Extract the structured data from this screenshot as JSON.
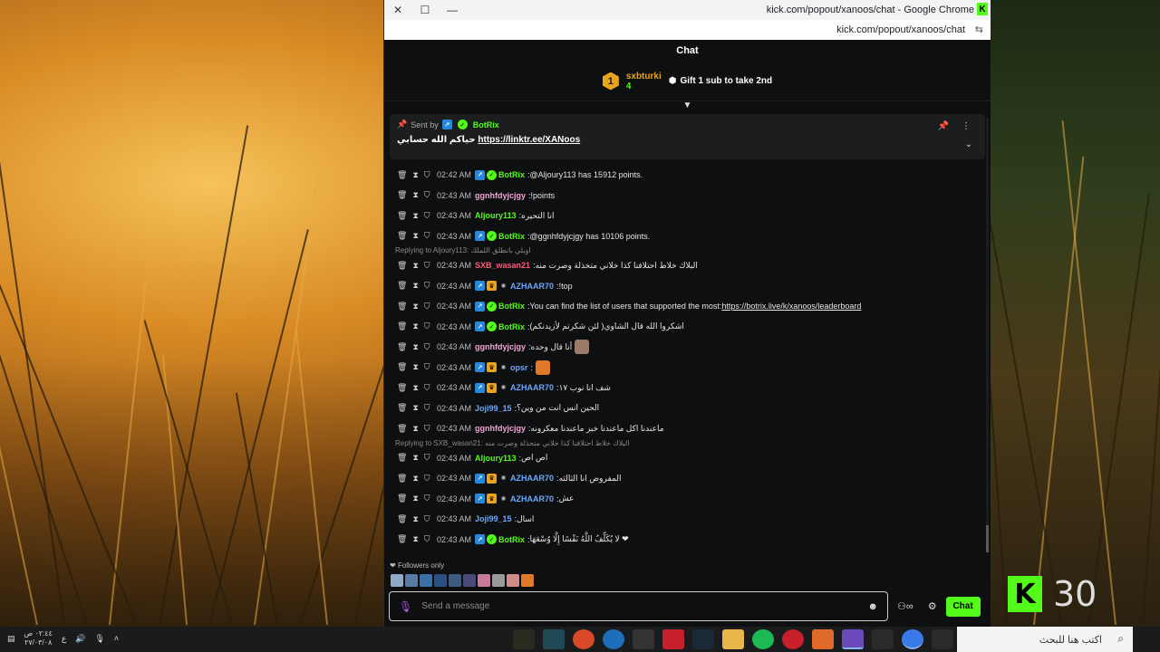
{
  "window": {
    "title": "kick.com/popout/xanoos/chat - Google Chrome",
    "url": "kick.com/popout/xanoos/chat"
  },
  "chat": {
    "header": "Chat",
    "leaderboard": {
      "rank": "1",
      "user": "sxbturki",
      "count": "4",
      "gift_text": "Gift 1 sub to take 2nd"
    },
    "pinned": {
      "sent_by_label": "Sent by",
      "sender": "BotRix",
      "message_prefix": "حياكم الله حسابي",
      "link": "https://linktr.ee/XANoos"
    },
    "messages": [
      {
        "time": "02:42 AM",
        "user": "BotRix",
        "color": "#53fc18",
        "badges": [
          "blue",
          "green"
        ],
        "text": "@Aljoury113 has 15912 points."
      },
      {
        "time": "02:43 AM",
        "user": "ggnhfdyjcjgy",
        "color": "#f0a7d4",
        "badges": [],
        "text": "!points"
      },
      {
        "time": "02:43 AM",
        "user": "Aljoury113",
        "color": "#53fc18",
        "badges": [],
        "text": "انا التحيره"
      },
      {
        "time": "02:43 AM",
        "user": "BotRix",
        "color": "#53fc18",
        "badges": [
          "blue",
          "green"
        ],
        "text": "@ggnhfdyjcjgy has 10106 points."
      },
      {
        "reply": "Replying to Aljoury113: اوبلي بانطلق اللملك"
      },
      {
        "time": "02:43 AM",
        "user": "SXB_wasan21",
        "color": "#ff5a7a",
        "badges": [],
        "text": "البلاك خلاط احتلافنا كذا خلاني متخذلة وصرت منه"
      },
      {
        "time": "02:43 AM",
        "user": "AZHAAR70",
        "color": "#6aa8ff",
        "badges": [
          "blue",
          "gold",
          "sub"
        ],
        "text": "!top"
      },
      {
        "time": "02:43 AM",
        "user": "BotRix",
        "color": "#53fc18",
        "badges": [
          "blue",
          "green"
        ],
        "text": "You can find the list of users that supported the most: ",
        "link": "https://botrix.live/k/xanoos/leaderboard"
      },
      {
        "time": "02:43 AM",
        "user": "BotRix",
        "color": "#53fc18",
        "badges": [
          "blue",
          "green"
        ],
        "text": "اشكروا الله قال الشاوي( لئن شكرتم لأزيدنكم)"
      },
      {
        "time": "02:43 AM",
        "user": "ggnhfdyjcjgy",
        "color": "#f0a7d4",
        "badges": [],
        "text": "أنا قال وحده",
        "emote": "#9a7b6a"
      },
      {
        "time": "02:43 AM",
        "user": "opsr",
        "color": "#6aa8ff",
        "badges": [
          "blue",
          "gold",
          "sub"
        ],
        "text": "",
        "emote": "#e07a2a"
      },
      {
        "time": "02:43 AM",
        "user": "AZHAAR70",
        "color": "#6aa8ff",
        "badges": [
          "blue",
          "gold",
          "sub"
        ],
        "text": "شف انا نوب ١٧"
      },
      {
        "time": "02:43 AM",
        "user": "Joji99_15",
        "color": "#6aa8ff",
        "badges": [],
        "text": "الحين انس انت من وين؟"
      },
      {
        "time": "02:43 AM",
        "user": "ggnhfdyjcjgy",
        "color": "#f0a7d4",
        "badges": [],
        "text": "ماعندنا اكل ماعندنا خبز ماعندنا معكرونه"
      },
      {
        "reply": "Replying to SXB_wasan21: البلاك خلاط احتلافنا كذا خلاني متخذلة وصرت منه"
      },
      {
        "time": "02:43 AM",
        "user": "Aljoury113",
        "color": "#53fc18",
        "badges": [],
        "text": "اص اص"
      },
      {
        "time": "02:43 AM",
        "user": "AZHAAR70",
        "color": "#6aa8ff",
        "badges": [
          "blue",
          "gold",
          "sub"
        ],
        "text": "المفروض انا الثالثه"
      },
      {
        "time": "02:43 AM",
        "user": "AZHAAR70",
        "color": "#6aa8ff",
        "badges": [
          "blue",
          "gold",
          "sub"
        ],
        "text": "عش"
      },
      {
        "time": "02:43 AM",
        "user": "Joji99_15",
        "color": "#6aa8ff",
        "badges": [],
        "text": "اسال"
      },
      {
        "time": "02:43 AM",
        "user": "BotRix",
        "color": "#53fc18",
        "badges": [
          "blue",
          "green"
        ],
        "text": "لا يُكَلِّفُ اللَّهُ نَفْسًا إِلَّا وُسْعَهَا ❤"
      }
    ],
    "followers_only": "Followers only",
    "input_placeholder": "Send a message",
    "send_label": "Chat"
  },
  "kick_widget": {
    "logo": "K",
    "count": "30"
  },
  "taskbar": {
    "time": "٠٢:٤٤ ص",
    "date": "٢٧/٠٣/٠٨",
    "lang": "ع",
    "search_placeholder": "اكتب هنا للبحث"
  },
  "colors": {
    "kick_green": "#53fc18",
    "bg": "#0e0f10"
  }
}
